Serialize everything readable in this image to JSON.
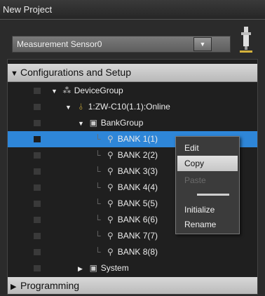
{
  "window": {
    "title": "New Project"
  },
  "toolbar": {
    "sensor_combo_value": "Measurement Sensor0",
    "combo_arrow": "▼"
  },
  "tree": {
    "configurations_header": "Configurations and Setup",
    "programming_header": "Programming",
    "device_group": "DeviceGroup",
    "device": "1:ZW-C10(1.1):Online",
    "bank_group": "BankGroup",
    "banks": [
      "BANK 1(1)",
      "BANK 2(2)",
      "BANK 3(3)",
      "BANK 4(4)",
      "BANK 5(5)",
      "BANK 6(6)",
      "BANK 7(7)",
      "BANK 8(8)"
    ],
    "system": "System",
    "selected_bank": "BANK 1(1)"
  },
  "context_menu": {
    "edit": "Edit",
    "copy": "Copy",
    "paste": "Paste",
    "initialize": "Initialize",
    "rename": "Rename"
  },
  "icons": {
    "expanded": "▼",
    "collapsed": "▶",
    "device_group": "group-icon",
    "device": "sensor-device-icon",
    "folder": "folder-icon",
    "bank": "bank-icon"
  },
  "colors": {
    "selection": "#2e86d8",
    "header": "#c8c8c8",
    "background": "#2b2b2b"
  }
}
